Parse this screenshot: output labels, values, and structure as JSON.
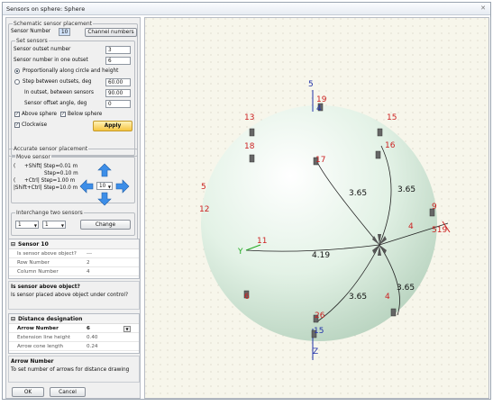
{
  "window": {
    "title": "Sensors on sphere: Sphere",
    "close_icon": "close-icon"
  },
  "schematic": {
    "label": "Schematic sensor placement",
    "sensor_number_label": "Sensor Number",
    "sensor_number_value": "10",
    "channel_button": "Channel numbers"
  },
  "set_sensors": {
    "label": "Set sensors",
    "outset_label": "Sensor outset number",
    "outset_value": "3",
    "one_outset_label": "Sensor number in one outset",
    "one_outset_value": "6",
    "radio1": "Proportionally along circle and height",
    "radio2": "Step between outsets, deg",
    "step_value": "60.00",
    "incutset_label": "In outset, between sensors",
    "incutset_value": "90.00",
    "offset_label": "Sensor offset angle, deg",
    "offset_value": "0",
    "above_label": "Above sphere",
    "below_label": "Below sphere",
    "clockwise_label": "Clockwise",
    "apply_button": "Apply"
  },
  "accurate": {
    "label": "Accurate sensor placement",
    "move_label": "Move sensor",
    "line1a": "+Shift| Step=0.01 m",
    "line1b": "Step=0.10 m",
    "line2": "+Ctrl| Step=1.00 m",
    "line3": "|Shift+Ctrl| Step=10.0 m",
    "paren": "(",
    "step_value": "10"
  },
  "interchange": {
    "label": "Interchange two sensors",
    "a": "1",
    "b": "1",
    "change_button": "Change"
  },
  "props1": {
    "header": "Sensor 10",
    "rows": [
      {
        "k": "Is sensor above object?",
        "v": "---"
      },
      {
        "k": "Row Number",
        "v": "2"
      },
      {
        "k": "Column Number",
        "v": "4"
      }
    ]
  },
  "desc1": {
    "title": "Is sensor above object?",
    "text": "Is sensor placed above object under control?"
  },
  "props2": {
    "header": "Distance designation",
    "rows": [
      {
        "k": "Arrow Number",
        "v": "6"
      },
      {
        "k": "Extension line height",
        "v": "0.40"
      },
      {
        "k": "Arrow cone length",
        "v": "0.24"
      }
    ]
  },
  "desc2": {
    "title": "Arrow Number",
    "text": "To set number of arrows for distance drawing"
  },
  "footer": {
    "ok": "OK",
    "cancel": "Cancel"
  },
  "scene": {
    "distances": [
      "3.65",
      "3.65",
      "4.19",
      "3.65",
      "3.65"
    ],
    "labels": [
      "5",
      "19",
      "4",
      "13",
      "15",
      "18",
      "16",
      "17",
      "5",
      "9",
      "12",
      "4",
      "519",
      "11",
      "Y",
      "6",
      "4",
      "26",
      "15",
      "Z"
    ],
    "axis_colors": {
      "x": "#cc2222",
      "y": "#22aa22",
      "z": "#2233aa"
    }
  }
}
